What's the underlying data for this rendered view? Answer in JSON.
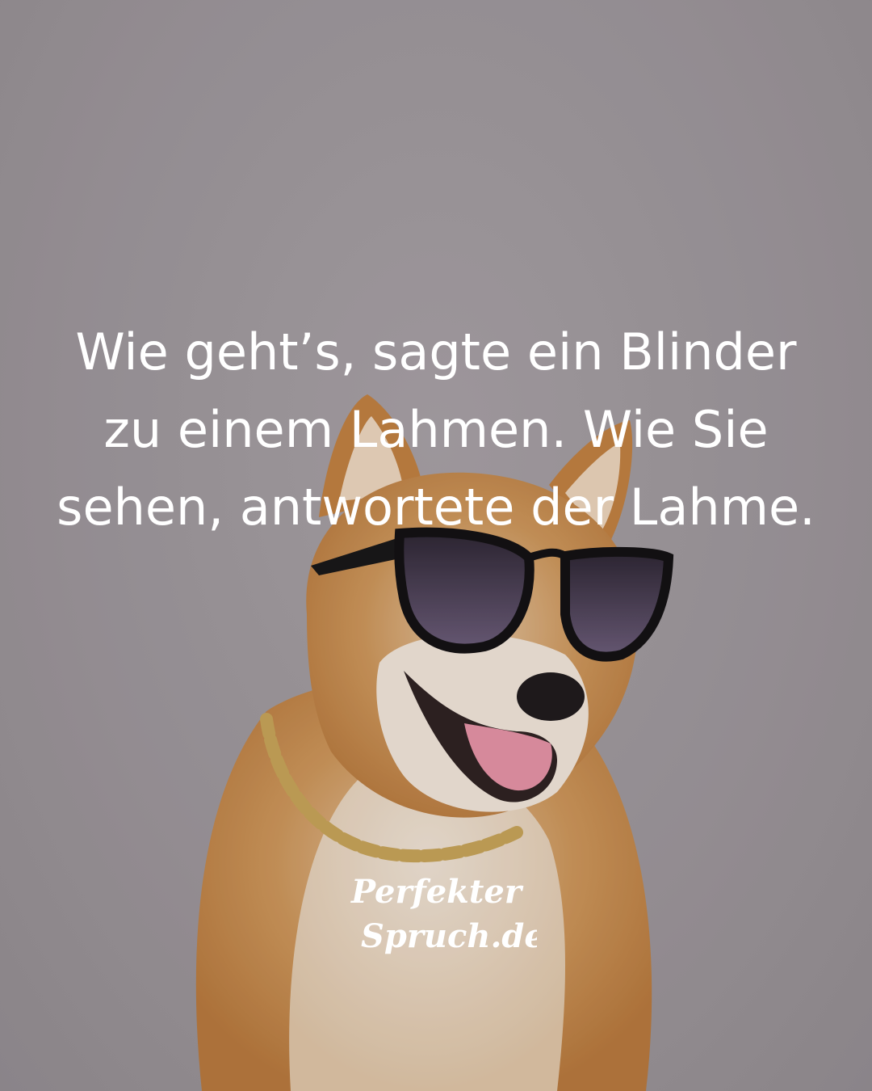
{
  "quote": {
    "lines": [
      "Wie geht’s, sagte ein Blinder",
      "zu einem Lahmen. Wie Sie",
      "sehen, antwortete der Lahme."
    ]
  },
  "logo": {
    "line1": "Perfekter",
    "line2": "Spruch.de"
  },
  "colors": {
    "background": "#9e979b",
    "text": "#ffffff",
    "fur": "#c98b4a",
    "fur_light": "#efdcc8"
  },
  "icons": {
    "dog": "shiba-dog-with-sunglasses",
    "sunglasses": "sunglasses-icon",
    "chain": "gold-chain-necklace"
  }
}
